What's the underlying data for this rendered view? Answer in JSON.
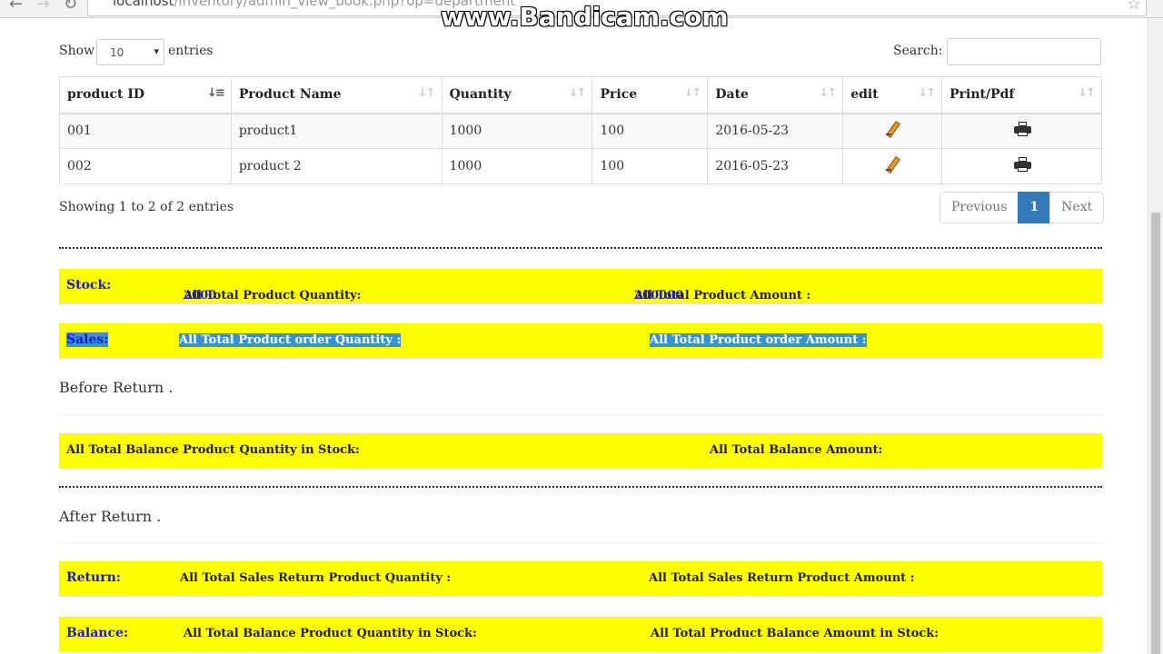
{
  "browser": {
    "url_prefix": "localhost",
    "url_path": "/inventory/admin_view_book.php?op=department"
  },
  "watermark": "www.Bandicam.com",
  "controls": {
    "show_label": "Show",
    "page_size": "10",
    "entries_label": "entries",
    "search_label": "Search:",
    "search_value": ""
  },
  "table": {
    "columns": [
      "product ID",
      "Product Name",
      "Quantity",
      "Price",
      "Date",
      "edit",
      "Print/Pdf"
    ],
    "rows": [
      {
        "id": "001",
        "name": "product1",
        "quantity": "1000",
        "price": "100",
        "date": "2016-05-23"
      },
      {
        "id": "002",
        "name": "product 2",
        "quantity": "1000",
        "price": "100",
        "date": "2016-05-23"
      }
    ]
  },
  "footer": {
    "showing": "Showing 1 to 2 of 2 entries",
    "previous": "Previous",
    "page": "1",
    "next": "Next"
  },
  "stock": {
    "label": "Stock:",
    "qty_label": "All Total Product Quantity:",
    "qty_value": "2000",
    "amount_label": "All Total Product Amount :",
    "amount_value": "200000"
  },
  "sales": {
    "label": "Sales:",
    "qty_label": "All Total Product order Quantity :",
    "amount_label": "All Total Product order Amount :"
  },
  "before_return": {
    "heading": "Before Return .",
    "qty_label": "All Total Balance Product Quantity in Stock:",
    "amount_label": "All Total Balance Amount:"
  },
  "after_return": {
    "heading": "After Return ."
  },
  "return": {
    "label": "Return:",
    "qty_label": "All Total Sales Return Product Quantity :",
    "amount_label": "All Total Sales Return Product Amount :"
  },
  "balance": {
    "label": "Balance:",
    "qty_label": "All Total Balance Product Quantity in Stock:",
    "amount_label": "All Total Product Balance Amount in Stock:"
  },
  "colors": {
    "highlight": "#ffff00",
    "label_blue": "#1a1acb",
    "pager_active": "#337ab7",
    "selection": "#3b8fd4"
  },
  "icons": {
    "edit": "pencil-icon",
    "print": "printer-icon",
    "sort": "sort-icon"
  }
}
